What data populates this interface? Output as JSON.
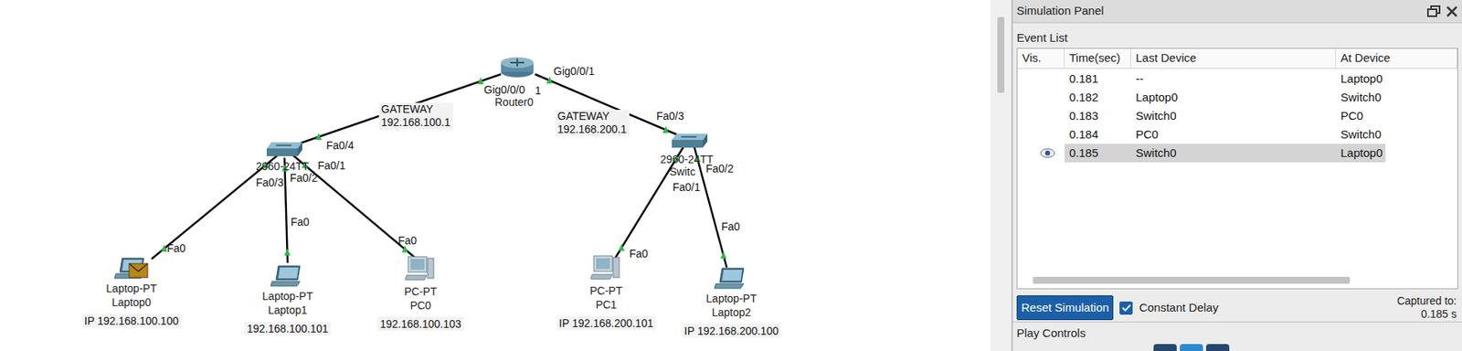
{
  "canvas": {
    "router": {
      "labels": [
        "Router0"
      ]
    },
    "switches": [
      {
        "labels": [
          "2960-24TT"
        ]
      },
      {
        "labels": [
          "2960-24TT",
          "Switc"
        ]
      }
    ],
    "port_labels": [
      "Gig0/0/0",
      "1",
      "Gig0/0/1",
      "Fa0/4",
      "Fa0/1",
      "Fa0/2",
      "Fa0/3",
      "Fa0/3",
      "Fa0/2",
      "Fa0/1",
      "Fa0",
      "Fa0",
      "Fa0",
      "Fa0",
      "Fa0"
    ],
    "notes": [
      {
        "lines": [
          "GATEWAY",
          "192.168.100.1"
        ]
      },
      {
        "lines": [
          "GATEWAY",
          "192.168.200.1"
        ]
      }
    ],
    "devices": [
      {
        "kind": "laptop",
        "type": "Laptop-PT",
        "name": "Laptop0",
        "ip": "IP 192.168.100.100",
        "has_packet": true
      },
      {
        "kind": "laptop",
        "type": "Laptop-PT",
        "name": "Laptop1",
        "ip": "192.168.100.101",
        "has_packet": false
      },
      {
        "kind": "pc",
        "type": "PC-PT",
        "name": "PC0",
        "ip": "192.168.100.103",
        "has_packet": false
      },
      {
        "kind": "pc",
        "type": "PC-PT",
        "name": "PC1",
        "ip": "IP 192.168.200.101",
        "has_packet": false
      },
      {
        "kind": "laptop",
        "type": "Laptop-PT",
        "name": "Laptop2",
        "ip": "IP 192.168.200.100",
        "has_packet": false
      }
    ]
  },
  "simulation_panel": {
    "title": "Simulation Panel",
    "section": "Event List",
    "columns": [
      "Vis.",
      "Time(sec)",
      "Last Device",
      "At Device"
    ],
    "events": [
      {
        "visible": false,
        "time": "0.181",
        "last_device": "--",
        "at_device": "Laptop0",
        "selected": false
      },
      {
        "visible": false,
        "time": "0.182",
        "last_device": "Laptop0",
        "at_device": "Switch0",
        "selected": false
      },
      {
        "visible": false,
        "time": "0.183",
        "last_device": "Switch0",
        "at_device": "PC0",
        "selected": false
      },
      {
        "visible": false,
        "time": "0.184",
        "last_device": "PC0",
        "at_device": "Switch0",
        "selected": false
      },
      {
        "visible": true,
        "time": "0.185",
        "last_device": "Switch0",
        "at_device": "Laptop0",
        "selected": true
      }
    ],
    "reset_button": "Reset Simulation",
    "constant_delay": {
      "label": "Constant Delay",
      "checked": true
    },
    "captured": {
      "label": "Captured to:",
      "value": "0.185 s"
    },
    "play_controls": "Play Controls"
  }
}
